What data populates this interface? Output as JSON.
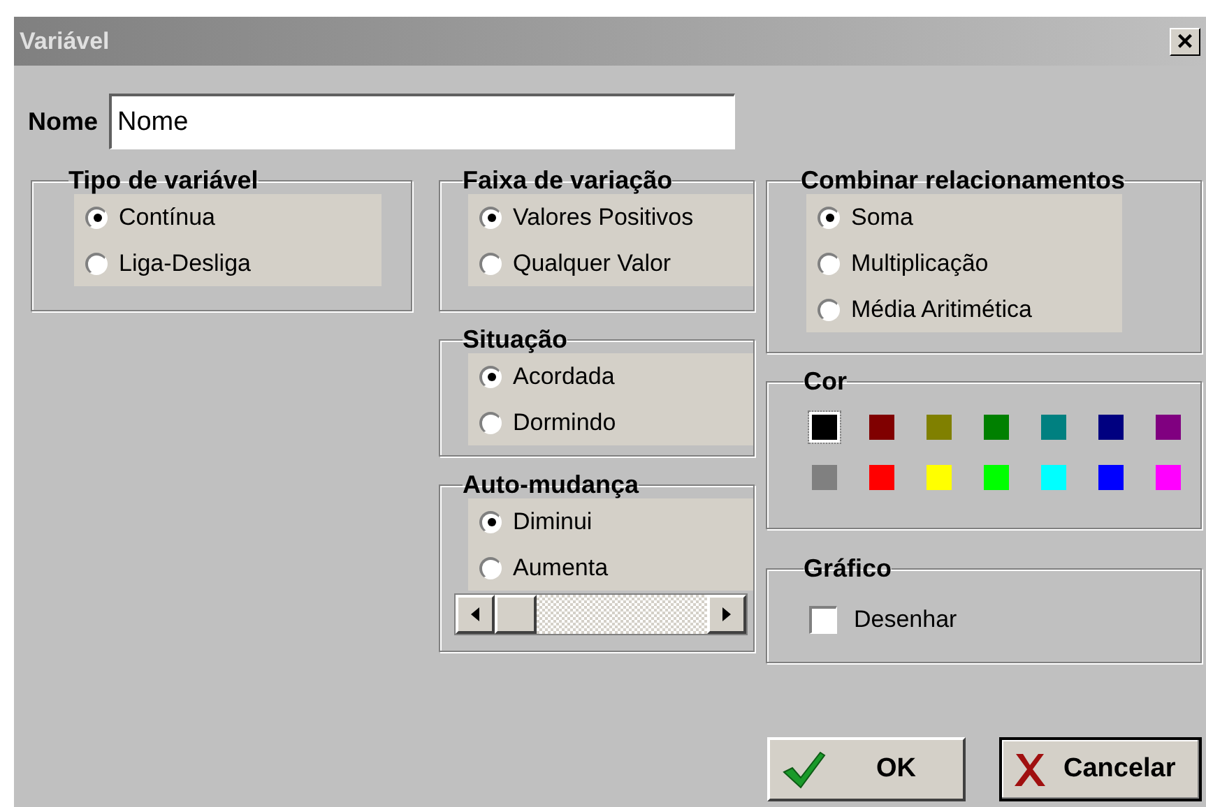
{
  "window": {
    "title": "Variável",
    "close_button": "×"
  },
  "name_field": {
    "label": "Nome",
    "value": "Nome"
  },
  "groups": {
    "tipo": {
      "title": "Tipo de variável",
      "options": [
        {
          "label": "Contínua",
          "selected": true
        },
        {
          "label": "Liga-Desliga",
          "selected": false
        }
      ]
    },
    "faixa": {
      "title": "Faixa de variação",
      "options": [
        {
          "label": "Valores Positivos",
          "selected": true
        },
        {
          "label": "Qualquer Valor",
          "selected": false
        }
      ]
    },
    "situacao": {
      "title": "Situação",
      "options": [
        {
          "label": "Acordada",
          "selected": true
        },
        {
          "label": "Dormindo",
          "selected": false
        }
      ]
    },
    "auto": {
      "title": "Auto-mudança",
      "options": [
        {
          "label": "Diminui",
          "selected": true
        },
        {
          "label": "Aumenta",
          "selected": false
        }
      ]
    },
    "combinar": {
      "title": "Combinar relacionamentos",
      "options": [
        {
          "label": "Soma",
          "selected": true
        },
        {
          "label": "Multiplicação",
          "selected": false
        },
        {
          "label": "Média Aritimética",
          "selected": false
        }
      ]
    }
  },
  "cor": {
    "title": "Cor",
    "swatches": [
      {
        "color": "#000000",
        "selected": true
      },
      {
        "color": "#800000",
        "selected": false
      },
      {
        "color": "#808000",
        "selected": false
      },
      {
        "color": "#008000",
        "selected": false
      },
      {
        "color": "#008080",
        "selected": false
      },
      {
        "color": "#000080",
        "selected": false
      },
      {
        "color": "#800080",
        "selected": false
      },
      {
        "color": "#808080",
        "selected": false
      },
      {
        "color": "#ff0000",
        "selected": false
      },
      {
        "color": "#ffff00",
        "selected": false
      },
      {
        "color": "#00ff00",
        "selected": false
      },
      {
        "color": "#00ffff",
        "selected": false
      },
      {
        "color": "#0000ff",
        "selected": false
      },
      {
        "color": "#ff00ff",
        "selected": false
      }
    ]
  },
  "grafico": {
    "title": "Gráfico",
    "checkbox": {
      "label": "Desenhar",
      "checked": false
    }
  },
  "buttons": [
    {
      "kind": "ok",
      "label": "OK",
      "default": false
    },
    {
      "kind": "cancel",
      "label": "Cancelar",
      "default": true
    }
  ]
}
